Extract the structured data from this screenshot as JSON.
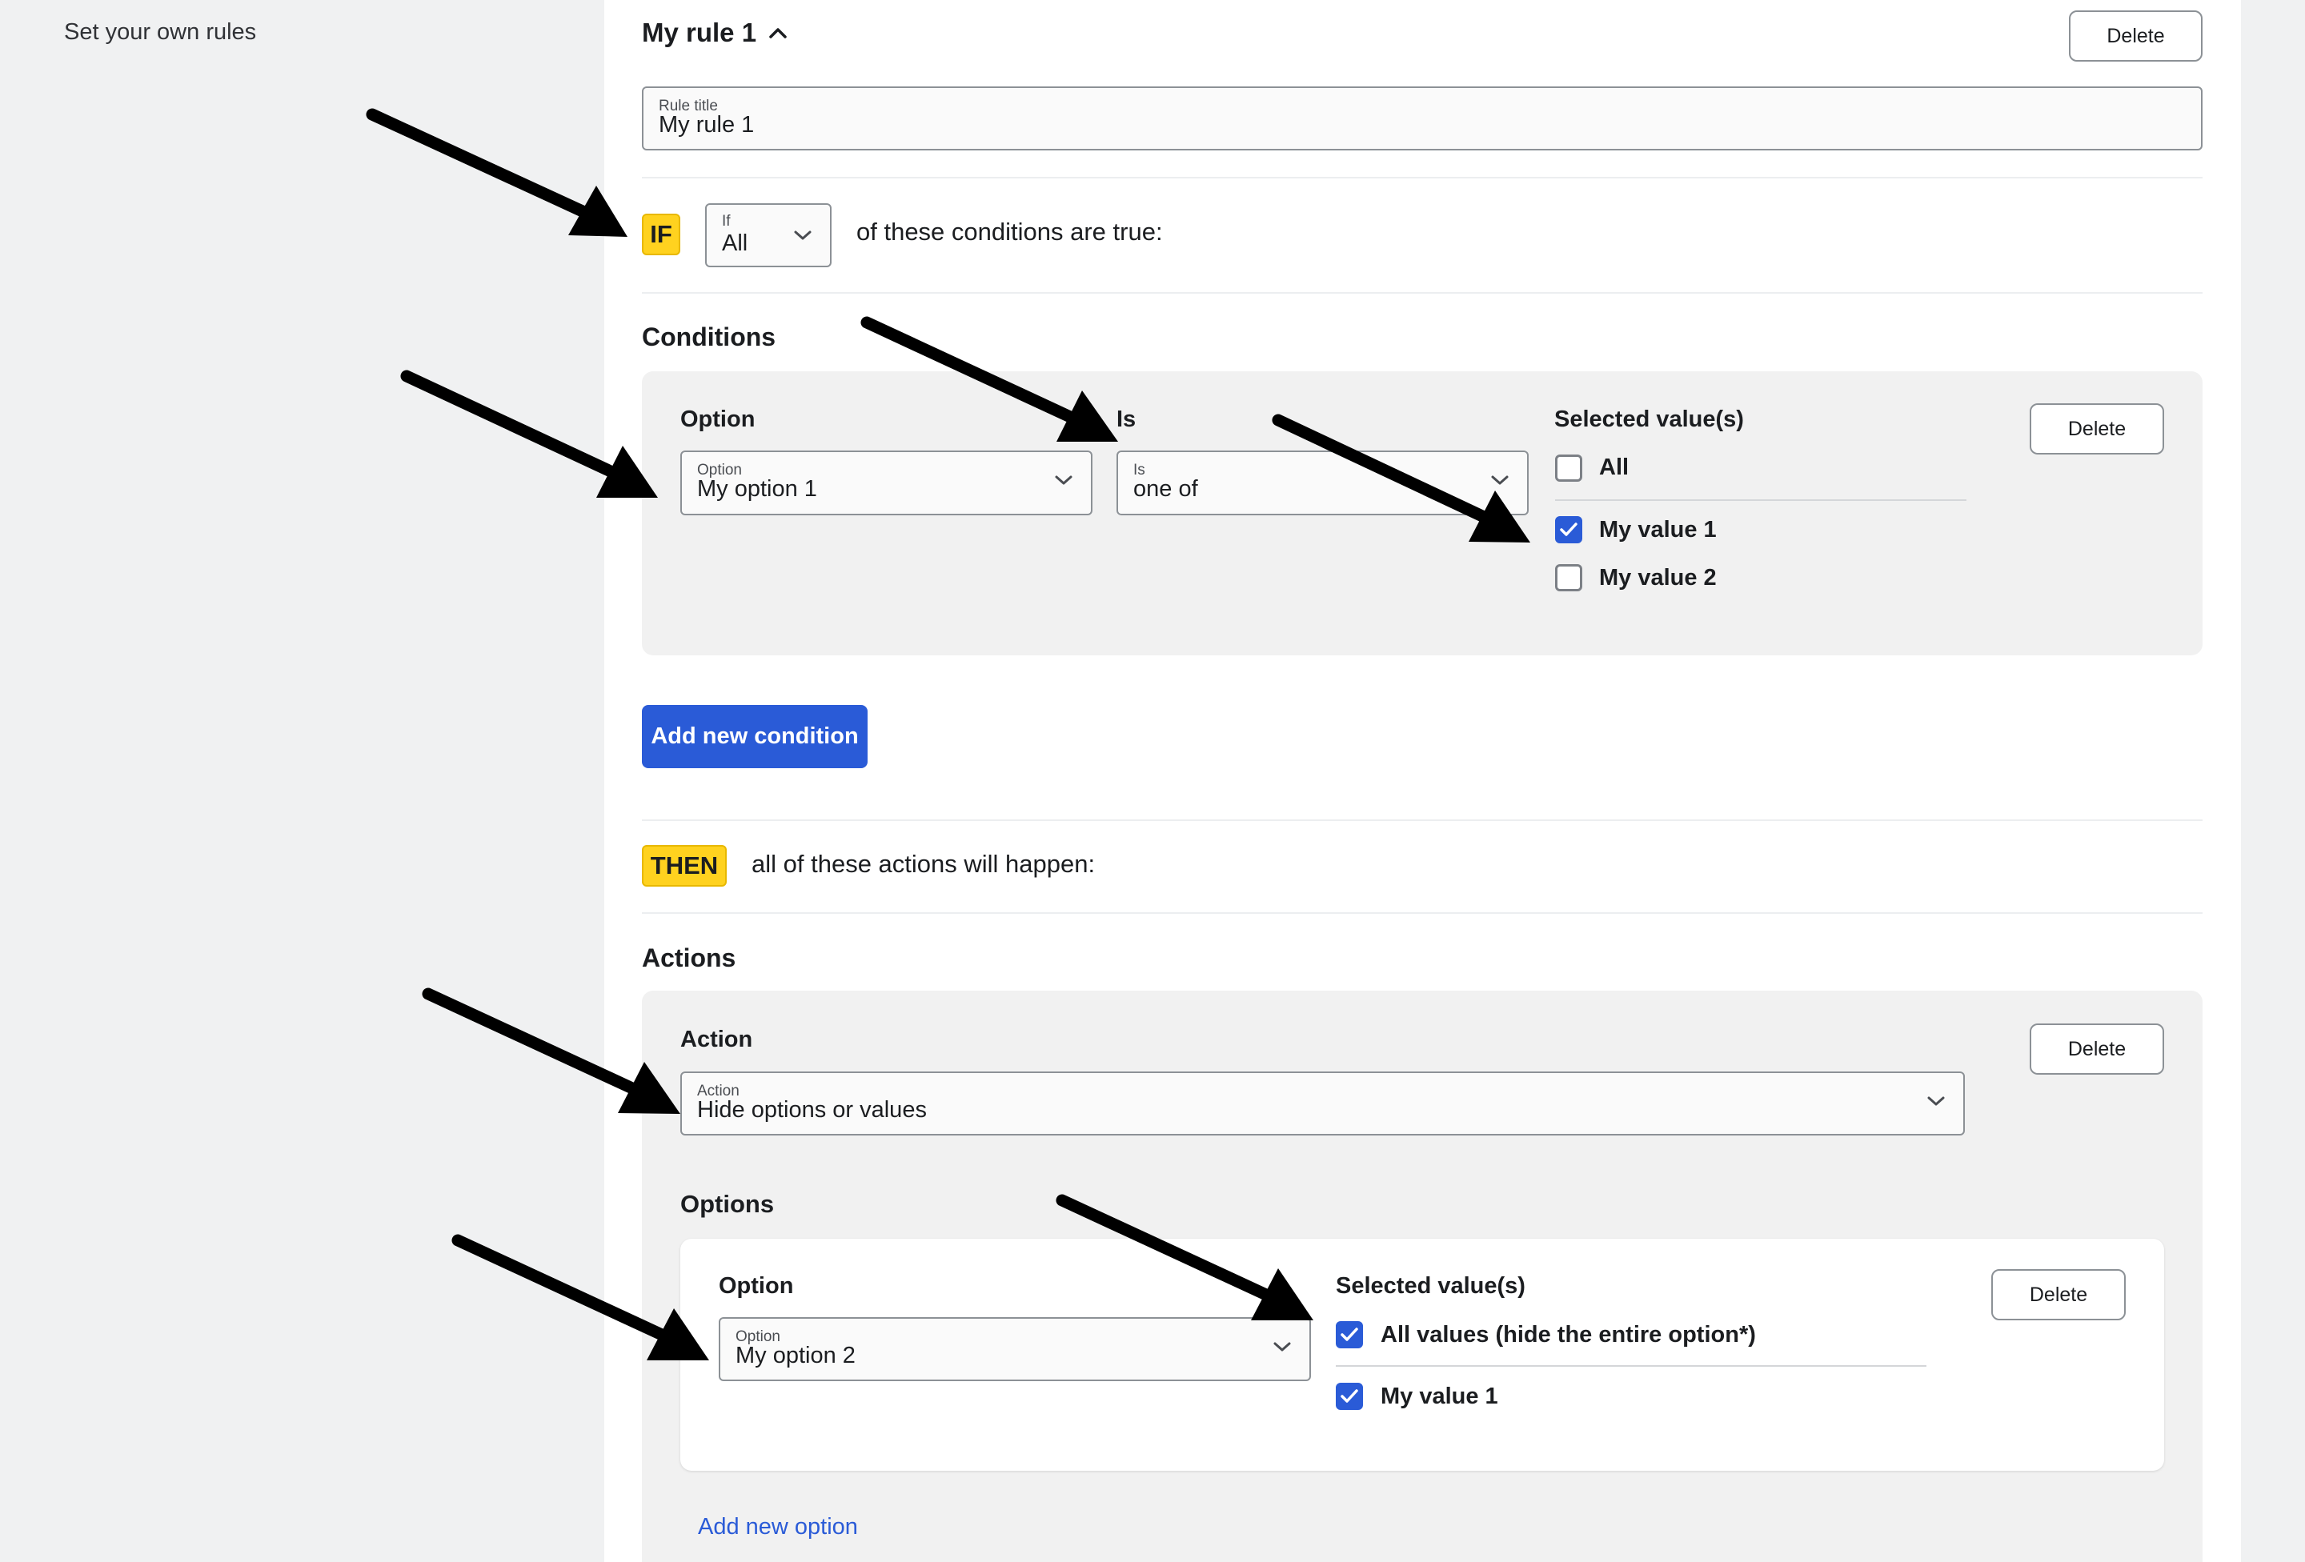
{
  "sidebar": {
    "label": "Set your own rules"
  },
  "rule": {
    "title": "My rule 1",
    "delete_label": "Delete",
    "title_field": {
      "label": "Rule title",
      "value": "My rule 1"
    }
  },
  "if_section": {
    "badge": "IF",
    "select": {
      "label": "If",
      "value": "All"
    },
    "text": "of these conditions are true:"
  },
  "conditions": {
    "heading": "Conditions",
    "option_col": "Option",
    "is_col": "Is",
    "values_col": "Selected value(s)",
    "option_field": {
      "label": "Option",
      "value": "My option 1"
    },
    "is_field": {
      "label": "Is",
      "value": "one of"
    },
    "values": [
      {
        "label": "All",
        "checked": false
      },
      {
        "label": "My value 1",
        "checked": true
      },
      {
        "label": "My value 2",
        "checked": false
      }
    ],
    "delete_label": "Delete",
    "add_button": "Add new condition"
  },
  "then_section": {
    "badge": "THEN",
    "text": "all of these actions will happen:"
  },
  "actions": {
    "heading": "Actions",
    "action_col": "Action",
    "action_field": {
      "label": "Action",
      "value": "Hide options or values"
    },
    "delete_label": "Delete",
    "options_heading": "Options",
    "option_block": {
      "option_col": "Option",
      "values_col": "Selected value(s)",
      "option_field": {
        "label": "Option",
        "value": "My option 2"
      },
      "values": [
        {
          "label": "All values (hide the entire option*)",
          "checked": true
        },
        {
          "label": "My value 1",
          "checked": true
        }
      ],
      "delete_label": "Delete"
    },
    "add_option_link": "Add new option"
  },
  "colors": {
    "primary": "#2a5bd7",
    "badge": "#ffd21f",
    "arrow": "#000000"
  }
}
